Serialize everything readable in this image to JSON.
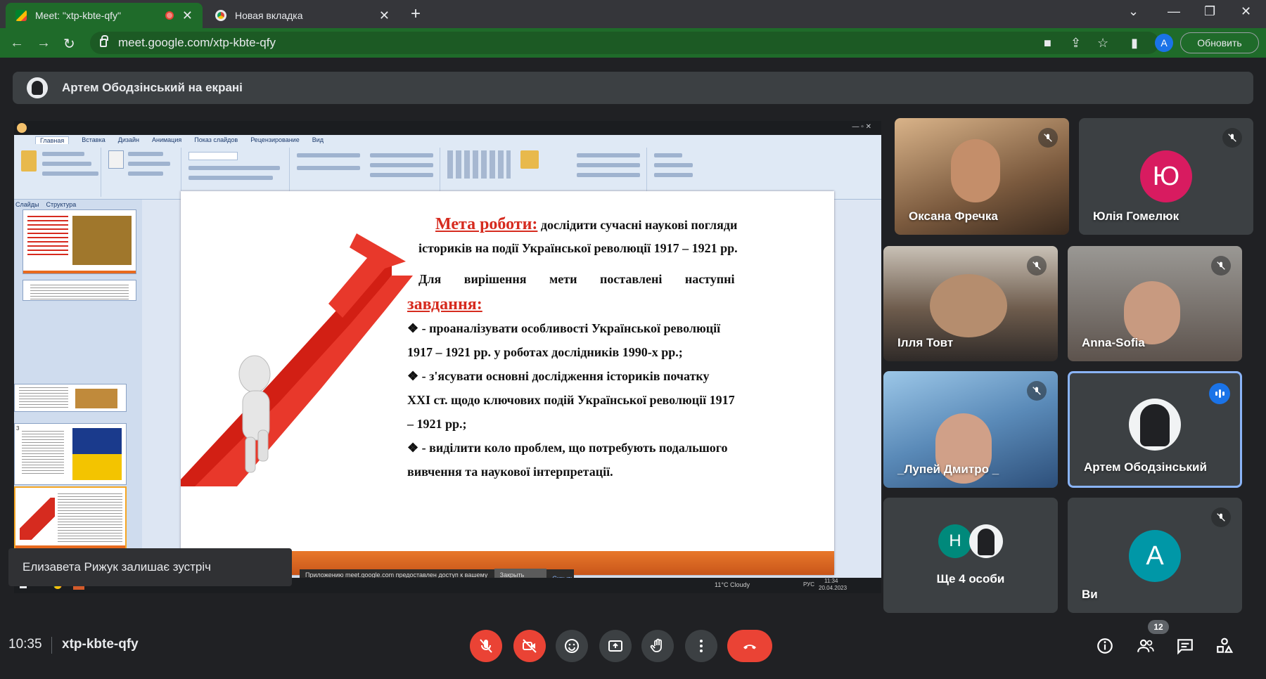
{
  "browser": {
    "tabs": [
      {
        "title": "Meet: \"xtp-kbte-qfy\"",
        "active": true,
        "recording": true
      },
      {
        "title": "Новая вкладка",
        "active": false
      }
    ],
    "url": "meet.google.com/xtp-kbte-qfy",
    "profile_initial": "A",
    "update_label": "Обновить"
  },
  "meet": {
    "presenting_banner": "Артем Ободзінський на екрані",
    "shared_screen": {
      "ribbon_tabs": [
        "Главная",
        "Вставка",
        "Дизайн",
        "Анимация",
        "Показ слайдов",
        "Рецензирование",
        "Вид"
      ],
      "panel_tabs": [
        "Слайды",
        "Структура"
      ],
      "slide": {
        "goal_title": "Мета роботи:",
        "goal_text_1": "дослідити сучасні наукові погляди",
        "goal_text_2": "істориків на події Української революції 1917 – 1921 рр.",
        "tasks_intro": "Для вирішення мети поставлені наступні",
        "tasks_title": "завдання:",
        "task1_line1": "❖ -   проаналізувати особливості Української революції",
        "task1_line2": "1917 – 1921 рр. у роботах дослідників 1990-х рр.;",
        "task2_line1": "❖ -   з'ясувати основні дослідження істориків початку",
        "task2_line2": "XXI ст. щодо ключових подій Української революції 1917",
        "task2_line3": "– 1921 рр.;",
        "task3_line1": "❖ -  виділити коло проблем, що потребують подальшого",
        "task3_line2": "вивчення та наукової інтерпретації."
      },
      "share_notice": "Приложению meet.google.com предоставлен доступ к вашему экрану.",
      "stop_share": "Закрыть доступ",
      "hide": "Скрыть",
      "weather": "11°C  Cloudy",
      "lang": "РУС",
      "tray_time": "11:34",
      "tray_date": "20.04.2023"
    },
    "toast": "Елизавета Рижук залишає зустріч",
    "participants": [
      {
        "name": "Оксана Фречка",
        "muted": true
      },
      {
        "name": "Юлія Гомелюк",
        "muted": true,
        "initial": "Ю",
        "color": "#d81b60"
      },
      {
        "name": "Ілля Товт",
        "muted": true
      },
      {
        "name": "Anna-Sofia",
        "muted": true
      },
      {
        "name": "_Лупей Дмитро _",
        "muted": true
      },
      {
        "name": "Артем Ободзінський",
        "speaking": true
      },
      {
        "name": "Ще 4 особи",
        "initial": "Н",
        "color": "#00897b"
      },
      {
        "name": "Ви",
        "muted": true,
        "initial": "A",
        "color": "#0097a7"
      }
    ],
    "clock": "10:35",
    "meeting_code": "xtp-kbte-qfy",
    "people_count": "12",
    "colors": {
      "accent_red": "#ea4335",
      "speaking_blue": "#1a73e8",
      "tile_bg": "#3c4043",
      "chrome_green": "#1f6b2a"
    }
  }
}
